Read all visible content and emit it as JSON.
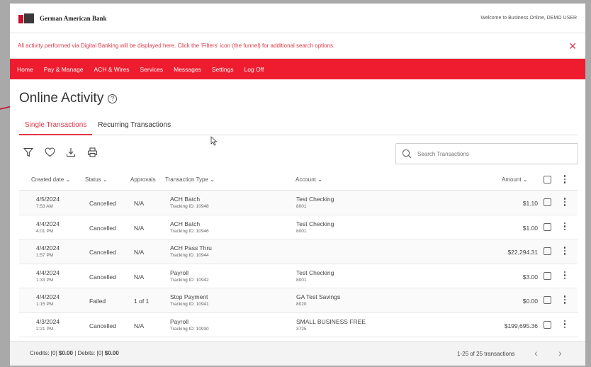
{
  "header": {
    "bank_name": "German American Bank",
    "welcome": "Welcome to Business Online, DEMO USER"
  },
  "notice": {
    "text": "All activity performed via Digital Banking will be displayed here. Click the 'Filters' icon (the funnel) for additional search options."
  },
  "nav": {
    "items": [
      {
        "label": "Home"
      },
      {
        "label": "Pay & Manage"
      },
      {
        "label": "ACH & Wires"
      },
      {
        "label": "Services"
      },
      {
        "label": "Messages"
      },
      {
        "label": "Settings"
      },
      {
        "label": "Log Off"
      }
    ]
  },
  "page": {
    "title": "Online Activity",
    "help_icon": "?"
  },
  "tabs": [
    {
      "label": "Single Transactions",
      "active": true
    },
    {
      "label": "Recurring Transactions",
      "active": false
    }
  ],
  "search": {
    "placeholder": "Search Transactions",
    "value": ""
  },
  "columns": {
    "created_date": "Created date",
    "status": "Status",
    "approvals": "Approvals",
    "transaction_type": "Transaction Type",
    "account": "Account",
    "amount": "Amount"
  },
  "rows": [
    {
      "date": "4/5/2024",
      "time": "7:53 AM",
      "status": "Cancelled",
      "approvals": "N/A",
      "type": "ACH Batch",
      "tracking": "Tracking ID: 10948",
      "account": "Test Checking",
      "account_no": "8001",
      "amount": "$1.10"
    },
    {
      "date": "4/4/2024",
      "time": "4:01 PM",
      "status": "Cancelled",
      "approvals": "N/A",
      "type": "ACH Batch",
      "tracking": "Tracking ID: 10946",
      "account": "Test Checking",
      "account_no": "8001",
      "amount": "$1.00"
    },
    {
      "date": "4/4/2024",
      "time": "1:57 PM",
      "status": "Cancelled",
      "approvals": "N/A",
      "type": "ACH Pass Thru",
      "tracking": "Tracking ID: 10944",
      "account": "",
      "account_no": "",
      "amount": "$22,294.31"
    },
    {
      "date": "4/4/2024",
      "time": "1:33 PM",
      "status": "Cancelled",
      "approvals": "N/A",
      "type": "Payroll",
      "tracking": "Tracking ID: 10942",
      "account": "Test Checking",
      "account_no": "8001",
      "amount": "$3.00"
    },
    {
      "date": "4/4/2024",
      "time": "1:15 PM",
      "status": "Failed",
      "approvals": "1 of 1",
      "type": "Stop Payment",
      "tracking": "Tracking ID: 10941",
      "account": "GA Test Savings",
      "account_no": "8020",
      "amount": "$0.00"
    },
    {
      "date": "4/3/2024",
      "time": "2:21 PM",
      "status": "Cancelled",
      "approvals": "N/A",
      "type": "Payroll",
      "tracking": "Tracking ID: 10930",
      "account": "SMALL BUSINESS FREE",
      "account_no": "3725",
      "amount": "$199,695.36"
    }
  ],
  "footer": {
    "credits_label": "Credits: [0]",
    "credits_value": "$0.00",
    "separator": "|",
    "debits_label": "Debits: [0]",
    "debits_value": "$0.00",
    "pager_text": "1-25 of 25 transactions"
  },
  "colors": {
    "brand_red": "#ee1c2e",
    "accent_text_red": "#e0384a",
    "annotation_arrow": "#c8102e"
  }
}
